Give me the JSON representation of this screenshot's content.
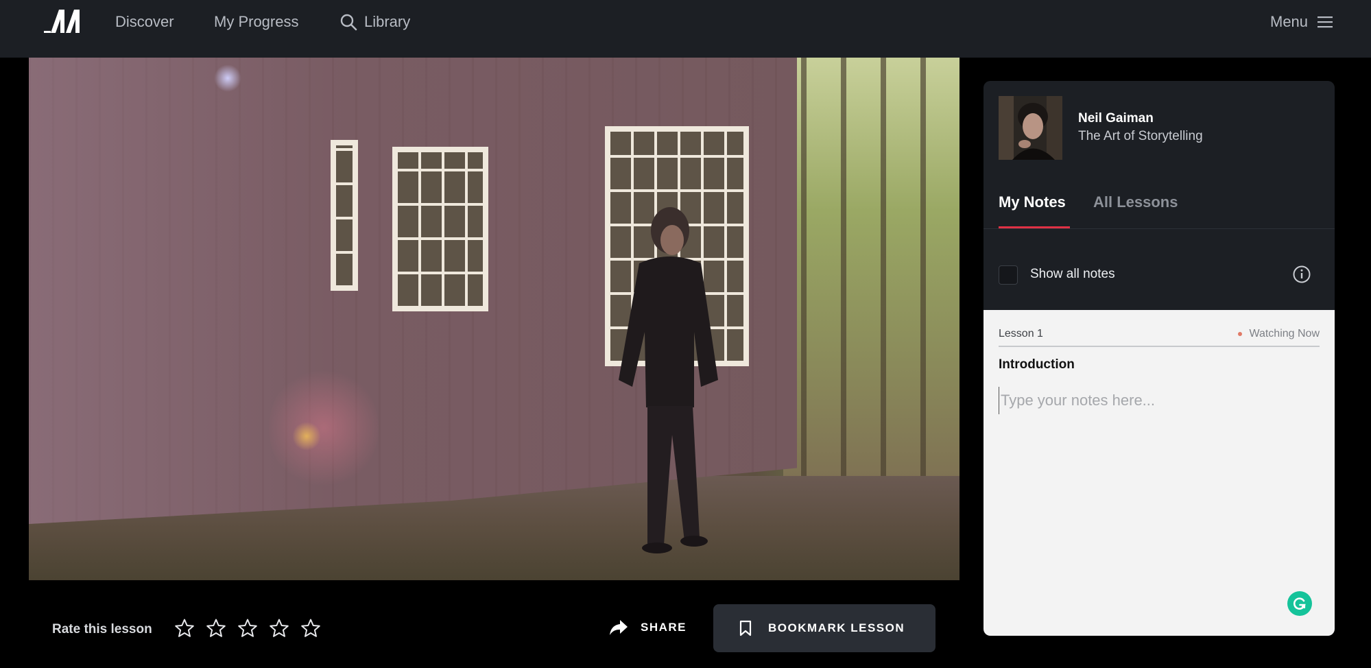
{
  "brand": {
    "logo_icon": "masterclass-logo-icon"
  },
  "nav": {
    "discover": "Discover",
    "my_progress": "My Progress",
    "library": "Library",
    "library_icon": "search-icon",
    "menu": "Menu",
    "menu_icon": "hamburger-icon"
  },
  "video": {
    "state": "playing"
  },
  "controls": {
    "rate_label": "Rate this lesson",
    "rating": {
      "value": 0,
      "max": 5,
      "icon": "star-outline-icon"
    },
    "share_label": "SHARE",
    "share_icon": "share-arrow-icon",
    "bookmark_label": "BOOKMARK LESSON",
    "bookmark_icon": "bookmark-icon"
  },
  "panel": {
    "author_name": "Neil Gaiman",
    "course_name": "The Art of Storytelling",
    "tabs": [
      {
        "label": "My Notes",
        "active": true
      },
      {
        "label": "All Lessons",
        "active": false
      }
    ],
    "show_all_notes_label": "Show all notes",
    "show_all_notes_checked": false,
    "info_icon": "info-circle-icon",
    "notes": {
      "lesson_number": "Lesson 1",
      "status": "Watching Now",
      "lesson_title": "Introduction",
      "placeholder": "Type your notes here...",
      "value": ""
    },
    "grammarly_icon": "grammarly-icon"
  },
  "colors": {
    "nav_bg": "#1c1f24",
    "accent_red": "#e03145",
    "grammarly_green": "#15c39a",
    "watching_dot": "#e07a66"
  }
}
